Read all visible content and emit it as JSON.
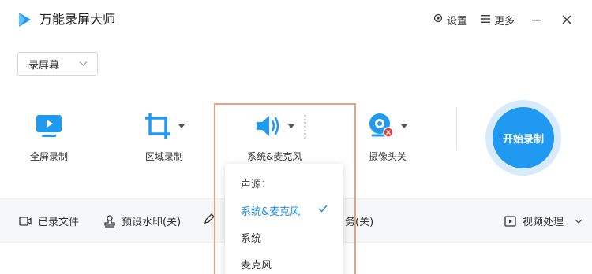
{
  "app": {
    "title": "万能录屏大师"
  },
  "titlebar": {
    "settings_label": "设置",
    "more_label": "更多"
  },
  "mode_select": {
    "value": "录屏幕"
  },
  "tools": {
    "fullscreen": "全屏录制",
    "region": "区域录制",
    "audio": "系统&麦克风",
    "camera": "摄像头关"
  },
  "start_button": {
    "label": "开始录制"
  },
  "bottom_bar": {
    "recorded_files": "已录文件",
    "watermark": "预设水印(关)",
    "task_suffix": "务(关)",
    "video_processing": "视频处理"
  },
  "audio_dropdown": {
    "heading": "声源：",
    "options": [
      "系统&麦克风",
      "系统",
      "麦克风"
    ],
    "selected": "系统&麦克风"
  },
  "colors": {
    "accent": "#1f9af0",
    "highlight_border": "#e9a27b",
    "selected_text": "#1f8fe6"
  }
}
